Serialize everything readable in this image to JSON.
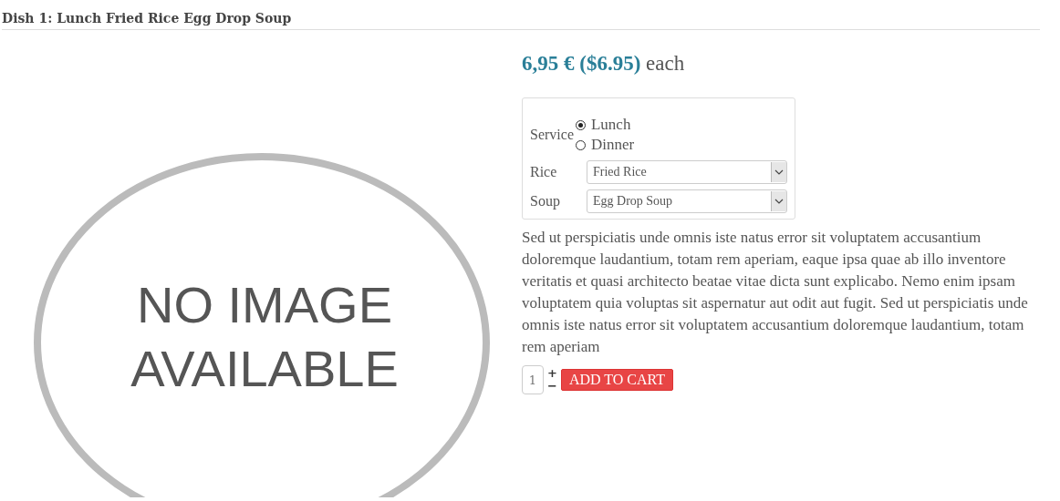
{
  "heading": "Dish 1: Lunch Fried Rice Egg Drop Soup",
  "image": {
    "line_1": "NO IMAGE",
    "line_2": "AVAILABLE"
  },
  "price": {
    "amount": "6,95 € ($6.95)",
    "unit": "each"
  },
  "options": {
    "service": {
      "label": "Service",
      "choices": [
        {
          "label": "Lunch",
          "selected": true
        },
        {
          "label": "Dinner",
          "selected": false
        }
      ]
    },
    "selects": [
      {
        "label": "Rice",
        "value": "Fried Rice"
      },
      {
        "label": "Soup",
        "value": "Egg Drop Soup"
      }
    ]
  },
  "description": "Sed ut perspiciatis unde omnis iste natus error sit voluptatem accusantium doloremque laudantium, totam rem aperiam, eaque ipsa quae ab illo inventore veritatis et quasi architecto beatae vitae dicta sunt explicabo. Nemo enim ipsam voluptatem quia voluptas sit aspernatur aut odit aut fugit. Sed ut perspiciatis unde omnis iste natus error sit voluptatem accusantium doloremque laudantium, totam rem aperiam",
  "cart": {
    "quantity": "1",
    "plus": "+",
    "minus": "−",
    "button": "ADD TO CART"
  }
}
